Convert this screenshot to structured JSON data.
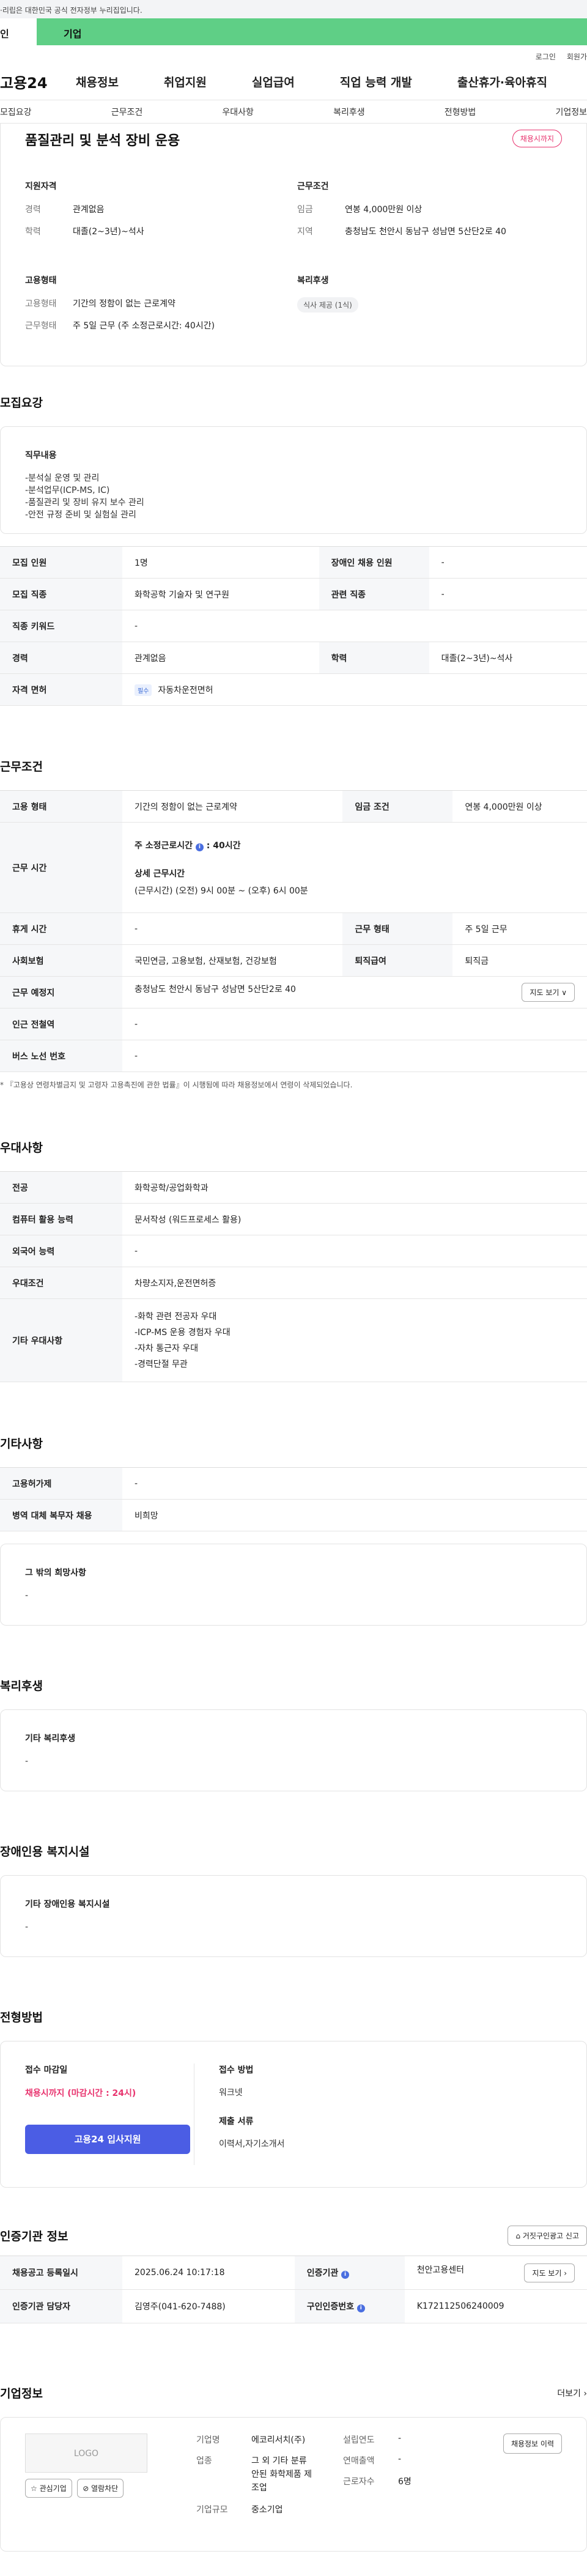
{
  "gov_banner": "·리립은 대한민국 공식 전자정부 누리집입니다.",
  "tabs": {
    "left": "인",
    "right": "기업"
  },
  "util": {
    "login": "로그인",
    "signup": "회원가"
  },
  "gnb": {
    "logo": "고용24",
    "items": [
      "채용정보",
      "취업지원",
      "실업급여",
      "직업 능력 개발",
      "출산휴가·육아휴직"
    ]
  },
  "subnav": [
    "모집요강",
    "근무조건",
    "우대사항",
    "복리후생",
    "전형방법",
    "기업정보"
  ],
  "summary": {
    "title": "품질관리 및 분석 장비 운용",
    "deadline_badge": "채용시까지",
    "qual": {
      "heading": "지원자격",
      "career_k": "경력",
      "career_v": "관계없음",
      "edu_k": "학력",
      "edu_v": "대졸(2~3년)~석사"
    },
    "cond": {
      "heading": "근무조건",
      "wage_k": "임금",
      "wage_v": "연봉 4,000만원 이상",
      "region_k": "지역",
      "region_v": "충청남도 천안시 동남구 성남면 5산단2로 40"
    },
    "emp": {
      "heading": "고용형태",
      "type_k": "고용형태",
      "type_v": "기간의 정함이 없는 근로계약",
      "form_k": "근무형태",
      "form_v": "주 5일 근무 (주 소정근로시간: 40시간)"
    },
    "welfare": {
      "heading": "복리후생",
      "chip": "식사 제공 (1식)"
    }
  },
  "recruit": {
    "title": "모집요강",
    "duty_heading": "직무내용",
    "duties": [
      "-분석실 운영 및 관리",
      "-분석업무(ICP-MS, IC)",
      "-품질관리 및 장비 유지 보수 관리",
      "-안전 규정 준비 및 실험실 관리"
    ],
    "rows": {
      "count_k": "모집 인원",
      "count_v": "1명",
      "disabled_k": "장애인 채용 인원",
      "disabled_v": "-",
      "job_k": "모집 직종",
      "job_v": "화학공학 기술자 및 연구원",
      "related_k": "관련 직종",
      "related_v": "-",
      "keyword_k": "직종 키워드",
      "keyword_v": "-",
      "career_k": "경력",
      "career_v": "관계없음",
      "edu_k": "학력",
      "edu_v": "대졸(2~3년)~석사",
      "license_k": "자격 면허",
      "license_tag": "필수",
      "license_v": "자동차운전면허"
    }
  },
  "conditions": {
    "title": "근무조건",
    "emp_k": "고용 형태",
    "emp_v": "기간의 정함이 없는 근로계약",
    "wage_k": "임금 조건",
    "wage_v": "연봉 4,000만원 이상",
    "hours_k": "근무 시간",
    "hours_main": "주 소정근로시간",
    "hours_value": ": 40시간",
    "detail_heading": "상세 근무시간",
    "detail_v": "(근무시간) (오전) 9시 00분 ~ (오후) 6시 00분",
    "rest_k": "휴게 시간",
    "rest_v": "-",
    "form_k": "근무 형태",
    "form_v": "주 5일 근무",
    "ins_k": "사회보험",
    "ins_v": "국민연금, 고용보험, 산재보험, 건강보험",
    "sev_k": "퇴직급여",
    "sev_v": "퇴직금",
    "place_k": "근무 예정지",
    "place_v": "충청남도 천안시 동남구 성남면 5산단2로 40",
    "map_btn": "지도 보기 ∨",
    "subway_k": "인근 전철역",
    "subway_v": "-",
    "bus_k": "버스 노선 번호",
    "bus_v": "-",
    "note": "* 『고용상 연령차별금지 및 고령자 고용촉진에 관한 법률』이 시행됨에 따라 채용정보에서 연령이 삭제되었습니다."
  },
  "prefs": {
    "title": "우대사항",
    "major_k": "전공",
    "major_v": "화학공학/공업화학과",
    "pc_k": "컴퓨터 활용 능력",
    "pc_v": "문서작성 (워드프로세스 활용)",
    "lang_k": "외국어 능력",
    "lang_v": "-",
    "cond_k": "우대조건",
    "cond_v": "차량소지자,운전면허증",
    "etc_k": "기타 우대사항",
    "etc_v": [
      "-화학 관련 전공자 우대",
      "-ICP-MS 운용 경험자 우대",
      "-자차 통근자 우대",
      "-경력단절 무관"
    ]
  },
  "others": {
    "title": "기타사항",
    "permit_k": "고용허가제",
    "permit_v": "-",
    "mil_k": "병역 대체 복무자 채용",
    "mil_v": "비희망",
    "wish_heading": "그 밖의 희망사항",
    "wish_v": "-"
  },
  "welfare": {
    "title": "복리후생",
    "heading": "기타 복리후생",
    "value": "-"
  },
  "disabled": {
    "title": "장애인용 복지시설",
    "heading": "기타 장애인용 복지시설",
    "value": "-"
  },
  "apply": {
    "title": "전형방법",
    "deadline_heading": "접수 마감일",
    "deadline_v": "채용시까지 (마감시간 : 24시)",
    "button": "고용24 입사지원",
    "method_heading": "접수 방법",
    "method_v": "워크넷",
    "docs_heading": "제출 서류",
    "docs_v": "이력서,자기소개서"
  },
  "agency": {
    "title": "인증기관 정보",
    "report_btn": "거짓구인광고 신고",
    "date_k": "채용공고 등록일시",
    "date_v": "2025.06.24 10:17:18",
    "org_k": "인증기관",
    "org_v": "천안고용센터",
    "map_btn": "지도 보기 ›",
    "staff_k": "인증기관 담당자",
    "staff_v": "김영주(041-620-7488)",
    "auth_k": "구인인증번호",
    "auth_v": "K172112506240009"
  },
  "company": {
    "title": "기업정보",
    "more": "더보기 ›",
    "logo": "LOGO",
    "fav_btn": "☆ 관심기업",
    "block_btn": "⊘ 열람차단",
    "name_k": "기업명",
    "name_v": "에코리서치(주)",
    "industry_k": "업종",
    "industry_v": [
      "그 외 기타 분류",
      "안된 화학제품 제",
      "조업"
    ],
    "scale_k": "기업규모",
    "scale_v": "중소기업",
    "year_k": "설립연도",
    "year_v": "-",
    "sales_k": "연매출액",
    "sales_v": "-",
    "emp_k": "근로자수",
    "emp_v": "6명",
    "history_btn": "채용정보 이력"
  }
}
